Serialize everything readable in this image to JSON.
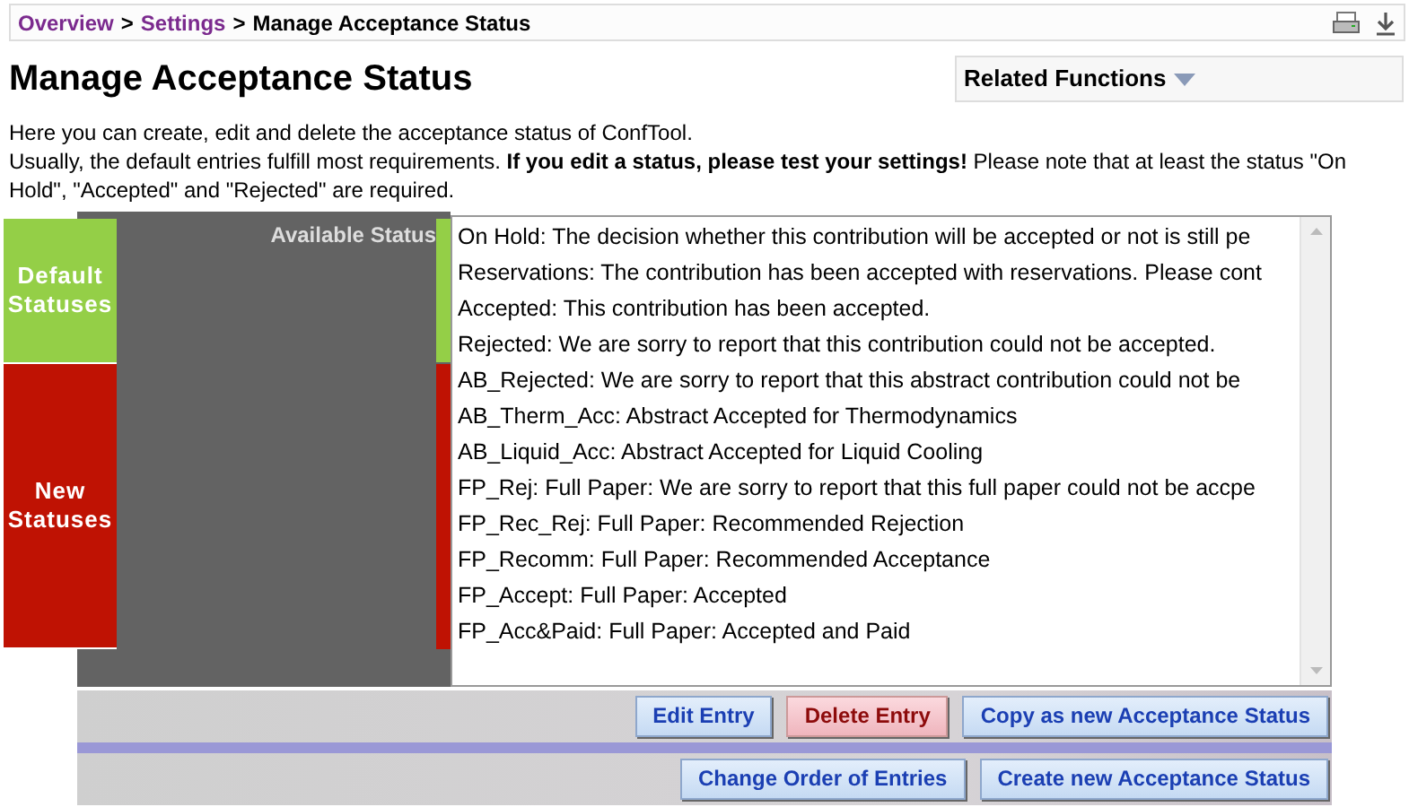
{
  "breadcrumb": [
    {
      "label": "Overview",
      "kind": "link"
    },
    {
      "label": "Settings",
      "kind": "link"
    },
    {
      "label": "Manage Acceptance Status",
      "kind": "current"
    }
  ],
  "breadcrumb_separator": ">",
  "title": "Manage Acceptance Status",
  "related_functions": {
    "label": "Related Functions"
  },
  "description": [
    "Here you can create, edit and delete the acceptance status of ConfTool.",
    "Usually, the default entries fulfill most requirements. **If you edit a status, please test your settings!** Please note that at least the status \"On Hold\", \"Accepted\" and \"Rejected\" are required."
  ],
  "status_list": {
    "heading": "Available Status",
    "groups": [
      {
        "label": "Default Statuses",
        "color": "#94cf47",
        "items": [
          {
            "text": "On Hold: The decision whether this contribution will be accepted or not is still pe"
          },
          {
            "text": "Reservations: The contribution has been accepted with reservations. Please cont"
          },
          {
            "text": "Accepted: This contribution has been accepted."
          },
          {
            "text": "Rejected: We are sorry to report that this contribution could not be accepted."
          }
        ]
      },
      {
        "label": "New Statuses",
        "color": "#bf1203",
        "items": [
          {
            "text": "AB_Rejected: We are sorry to report that this abstract contribution could not be"
          },
          {
            "text": "AB_Therm_Acc: Abstract Accepted for Thermodynamics"
          },
          {
            "text": "AB_Liquid_Acc: Abstract Accepted for Liquid Cooling"
          },
          {
            "text": "FP_Rej: Full Paper: We are sorry to report that this full paper could not be accpe"
          },
          {
            "text": "FP_Rec_Rej: Full Paper: Recommended Rejection"
          },
          {
            "text": "FP_Recomm: Full Paper: Recommended Acceptance"
          },
          {
            "text": "FP_Accept: Full Paper: Accepted"
          },
          {
            "text": "FP_Acc&Paid: Full Paper: Accepted and Paid"
          }
        ]
      }
    ]
  },
  "button_rows": [
    [
      {
        "label": "Edit Entry",
        "kind": "default"
      },
      {
        "label": "Delete Entry",
        "kind": "danger"
      },
      {
        "label": "Copy as new Acceptance Status",
        "kind": "default"
      }
    ],
    [
      {
        "label": "Change Order of Entries",
        "kind": "default"
      },
      {
        "label": "Create new Acceptance Status",
        "kind": "default"
      }
    ]
  ]
}
